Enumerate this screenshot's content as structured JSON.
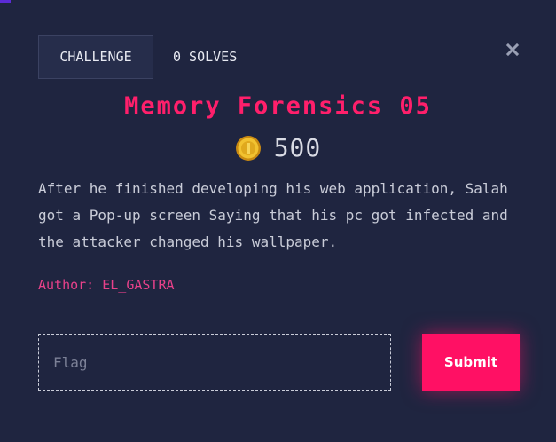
{
  "tabs": {
    "challenge_label": "CHALLENGE",
    "solves_label": "0 SOLVES"
  },
  "close_icon": "close-icon",
  "challenge": {
    "title": "Memory Forensics 05",
    "points": "500",
    "description": "After he finished developing his web application, Salah got a Pop-up screen Saying that his pc got infected and the attacker changed his wallpaper.",
    "author": "Author: EL_GASTRA"
  },
  "flag": {
    "placeholder": "Flag",
    "value": ""
  },
  "submit_label": "Submit",
  "colors": {
    "background": "#1f2540",
    "accent": "#ff1064",
    "title": "#ff1f6b",
    "author": "#e8418a",
    "coin": "#f2c230"
  }
}
